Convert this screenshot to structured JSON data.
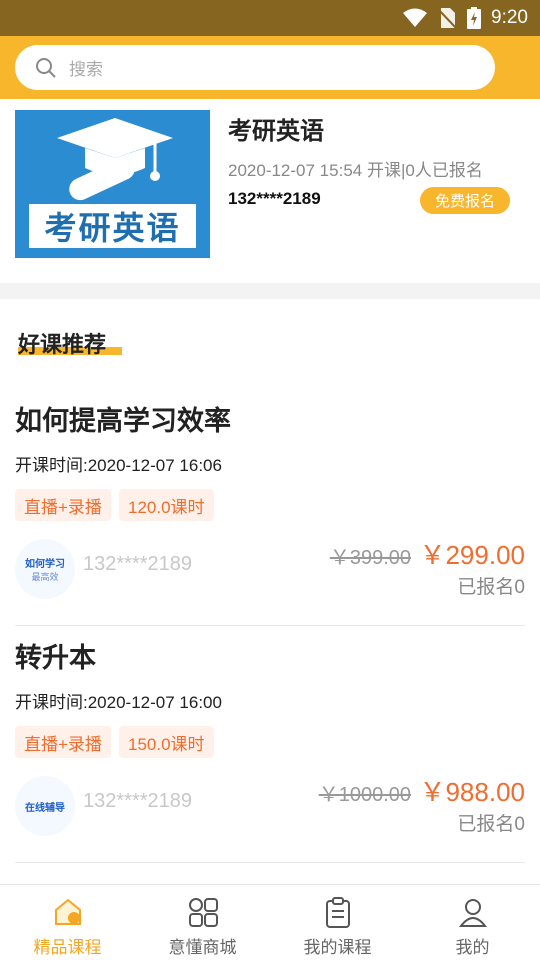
{
  "status_bar": {
    "time": "9:20"
  },
  "search": {
    "placeholder": "搜索"
  },
  "featured_course": {
    "cover_text": "考研英语",
    "title": "考研英语",
    "meta": "2020-12-07 15:54 开课|0人已报名",
    "user": "132****2189",
    "button": "免费报名"
  },
  "recommend": {
    "title": "好课推荐",
    "items": [
      {
        "name": "如何提高学习效率",
        "time": "开课时间:2020-12-07 16:06",
        "tag1": "直播+录播",
        "tag2": "120.0课时",
        "avatar_line1": "如何学习",
        "avatar_line2": "最高效",
        "user": "132****2189",
        "old_price": "￥399.00",
        "price": "￥299.00",
        "enrolled": "已报名0"
      },
      {
        "name": "转升本",
        "time": "开课时间:2020-12-07 16:00",
        "tag1": "直播+录播",
        "tag2": "150.0课时",
        "avatar_line1": "在线辅导",
        "avatar_line2": "",
        "user": "132****2189",
        "old_price": "￥1000.00",
        "price": "￥988.00",
        "enrolled": "已报名0"
      }
    ]
  },
  "bottom_nav": [
    {
      "label": "精品课程",
      "icon": "home-icon",
      "active": true
    },
    {
      "label": "意懂商城",
      "icon": "grid-icon",
      "active": false
    },
    {
      "label": "我的课程",
      "icon": "clipboard-icon",
      "active": false
    },
    {
      "label": "我的",
      "icon": "user-icon",
      "active": false
    }
  ],
  "colors": {
    "accent": "#f8b62d",
    "price": "#f26c2d",
    "status_bar": "#866520"
  }
}
